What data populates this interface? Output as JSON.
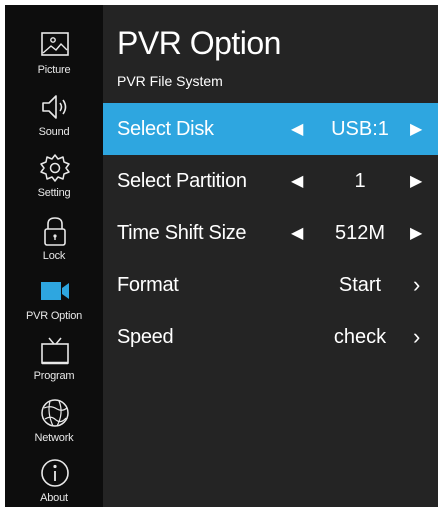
{
  "sidebar": {
    "items": [
      {
        "label": "Picture",
        "icon": "picture-icon"
      },
      {
        "label": "Sound",
        "icon": "speaker-icon"
      },
      {
        "label": "Setting",
        "icon": "gear-icon"
      },
      {
        "label": "Lock",
        "icon": "lock-icon"
      },
      {
        "label": "PVR Option",
        "icon": "camera-icon",
        "active": true
      },
      {
        "label": "Program",
        "icon": "tv-icon"
      },
      {
        "label": "Network",
        "icon": "globe-icon"
      },
      {
        "label": "About",
        "icon": "info-icon"
      }
    ]
  },
  "header": {
    "title": "PVR Option",
    "subtitle": "PVR File System"
  },
  "options": [
    {
      "label": "Select Disk",
      "value": "USB:1",
      "selected": true
    },
    {
      "label": "Select Partition",
      "value": "1"
    },
    {
      "label": "Time Shift Size",
      "value": "512M"
    },
    {
      "label": "Format",
      "value": "Start"
    },
    {
      "label": "Speed",
      "value": "check"
    }
  ],
  "colors": {
    "selected_row": "#2ea6e0",
    "active_icon": "#2ea6e0",
    "panel_bg": "#242424",
    "sidebar_bg": "#0d0d0d"
  }
}
